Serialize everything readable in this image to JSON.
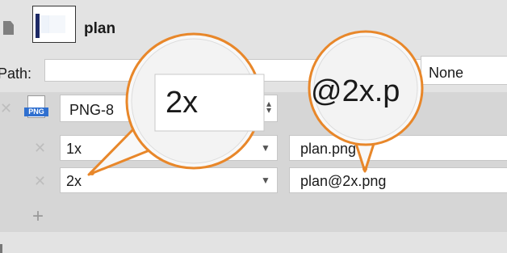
{
  "header": {
    "title": "plan"
  },
  "path": {
    "label": "Path:",
    "value": "",
    "suffix_value": "None"
  },
  "export": {
    "format_value": "PNG-8",
    "format_icon_label": "PNG",
    "rows": [
      {
        "scale": "1x",
        "filename": "plan.png"
      },
      {
        "scale": "2x",
        "filename": "plan@2x.png"
      }
    ]
  },
  "callouts": [
    {
      "text": "2x"
    },
    {
      "text": "@2x.p"
    }
  ],
  "colors": {
    "accent": "#e8872a",
    "panel": "#d6d6d6",
    "background": "#e3e3e3"
  },
  "icons": [
    "file-icon",
    "remove-icon",
    "png-file-icon",
    "dropdown-arrow-icon",
    "stepper-icon",
    "add-icon"
  ]
}
